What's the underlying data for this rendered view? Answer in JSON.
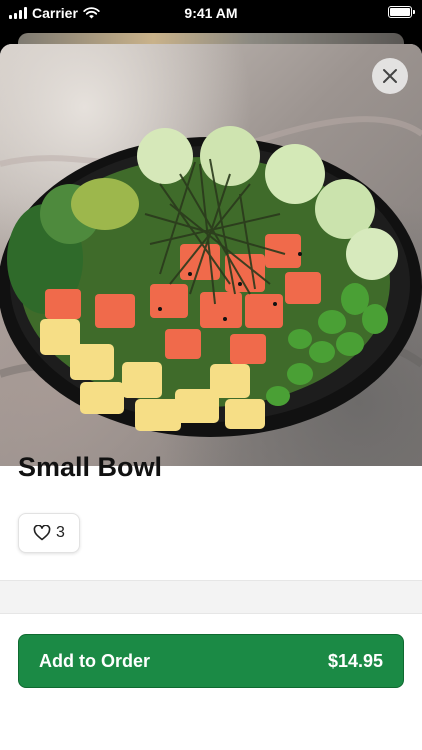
{
  "status_bar": {
    "carrier": "Carrier",
    "time": "9:41 AM"
  },
  "item": {
    "title": "Small Bowl",
    "image_icon": "poke-bowl-photo",
    "likes_count": "3"
  },
  "actions": {
    "close_icon": "close-icon",
    "add_label": "Add to Order",
    "price": "$14.95"
  },
  "colors": {
    "accent": "#1b8a45"
  }
}
